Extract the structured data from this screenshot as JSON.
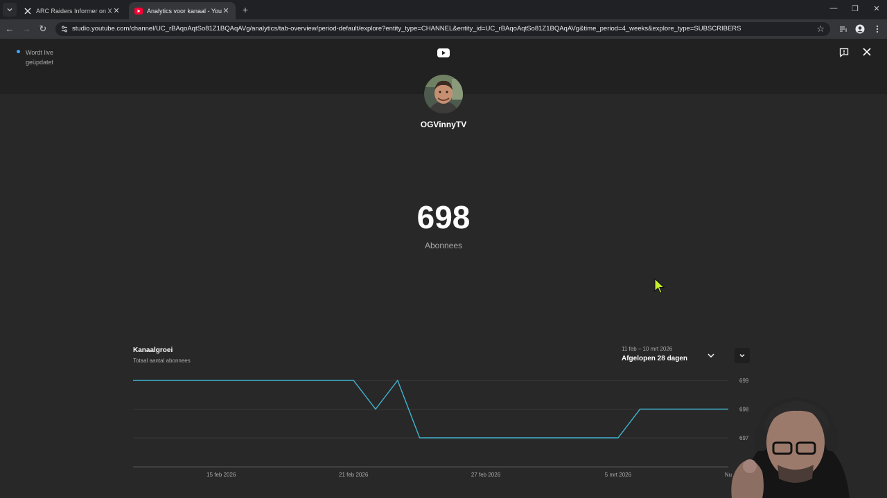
{
  "browser": {
    "tabs": [
      {
        "title": "ARC Raiders Informer on X: \"Th",
        "favicon": "x-logo-icon",
        "active": false
      },
      {
        "title": "Analytics voor kanaal - YouTube",
        "favicon": "youtube-studio-icon",
        "active": true
      }
    ],
    "new_tab_label": "+",
    "url": "studio.youtube.com/channel/UC_rBAqoAqtSo81Z1BQAqAVg/analytics/tab-overview/period-default/explore?entity_type=CHANNEL&entity_id=UC_rBAqoAqtSo81Z1BQAqAVg&time_period=4_weeks&explore_type=SUBSCRIBERS"
  },
  "header": {
    "live_status": "Wordt live geüpdatet",
    "logo": "youtube-icon"
  },
  "channel": {
    "name": "OGVinnyTV"
  },
  "stats": {
    "subscriber_count": "698",
    "subscriber_label": "Abonnees"
  },
  "card": {
    "title": "Kanaalgroei",
    "subtitle": "Totaal aantal abonnees",
    "period_range": "11 feb – 10 mrt 2026",
    "period_label": "Afgelopen 28 dagen"
  },
  "colors": {
    "accent": "#3ea6ff",
    "line": "#41b4d2",
    "background": "#282828"
  },
  "chart_data": {
    "type": "line",
    "title": "Kanaalgroei",
    "subtitle": "Totaal aantal abonnees",
    "x": [
      "2026-02-11",
      "2026-02-12",
      "2026-02-13",
      "2026-02-14",
      "2026-02-15",
      "2026-02-16",
      "2026-02-17",
      "2026-02-18",
      "2026-02-19",
      "2026-02-20",
      "2026-02-21",
      "2026-02-22",
      "2026-02-23",
      "2026-02-24",
      "2026-02-25",
      "2026-02-26",
      "2026-02-27",
      "2026-02-28",
      "2026-03-01",
      "2026-03-02",
      "2026-03-03",
      "2026-03-04",
      "2026-03-05",
      "2026-03-06",
      "2026-03-07",
      "2026-03-08",
      "2026-03-09",
      "2026-03-10"
    ],
    "series": [
      {
        "values": [
          699,
          699,
          699,
          699,
          699,
          699,
          699,
          699,
          699,
          699,
          699,
          698,
          699,
          697,
          697,
          697,
          697,
          697,
          697,
          697,
          697,
          697,
          697,
          698,
          698,
          698,
          698,
          698
        ]
      }
    ],
    "x_ticks": [
      "15 feb 2026",
      "21 feb 2026",
      "27 feb 2026",
      "5 mrt 2026",
      "Nu"
    ],
    "y_ticks": [
      "699",
      "698",
      "697"
    ],
    "ylim": [
      696,
      699
    ],
    "grid": true
  }
}
